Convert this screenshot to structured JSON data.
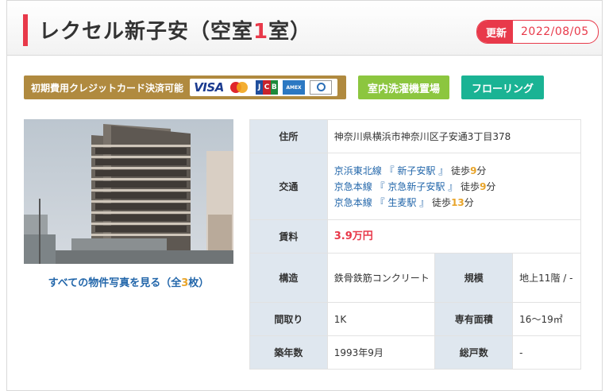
{
  "header": {
    "title_prefix": "レクセル新子安（空室",
    "vacant_count": "1",
    "title_suffix": "室）",
    "update_label": "更新",
    "update_date": "2022/08/05"
  },
  "tags": {
    "credit_card": "初期費用クレジットカード決済可能",
    "card_brands": [
      "VISA",
      "MasterCard",
      "JCB",
      "AMEX",
      "Diners"
    ],
    "visa_text": "VISA",
    "jcb_letters": [
      "J",
      "C",
      "B"
    ],
    "amex_text": "AMEX",
    "laundry": "室内洗濯機置場",
    "flooring": "フローリング"
  },
  "photo": {
    "link_prefix": "すべての物件写真を見る（全",
    "count": "3",
    "link_suffix": "枚）"
  },
  "details": {
    "address_label": "住所",
    "address": "神奈川県横浜市神奈川区子安通3丁目378",
    "transit_label": "交通",
    "transit": [
      {
        "line": "京浜東北線",
        "station": "『 新子安駅 』",
        "walk_prefix": "徒歩",
        "minutes": "9",
        "unit": "分"
      },
      {
        "line": "京急本線",
        "station": "『 京急新子安駅 』",
        "walk_prefix": "徒歩",
        "minutes": "9",
        "unit": "分"
      },
      {
        "line": "京急本線",
        "station": "『 生麦駅 』",
        "walk_prefix": "徒歩",
        "minutes": "13",
        "unit": "分"
      }
    ],
    "rent_label": "賃料",
    "rent": "3.9万円",
    "structure_label": "構造",
    "structure": "鉄骨鉄筋コンクリート",
    "scale_label": "規模",
    "scale": "地上11階 / -",
    "layout_label": "間取り",
    "layout": "1K",
    "area_label": "専有面積",
    "area": "16～19㎡",
    "built_label": "築年数",
    "built": "1993年9月",
    "units_label": "総戸数",
    "units": "-"
  },
  "colors": {
    "accent_red": "#e8394a",
    "card_tag_gold": "#b08a3f",
    "green_tag": "#8cc63f",
    "teal_tag": "#1ab394",
    "link_blue": "#2266aa",
    "number_orange": "#e8a42a",
    "table_header_bg": "#dfe7ef"
  }
}
